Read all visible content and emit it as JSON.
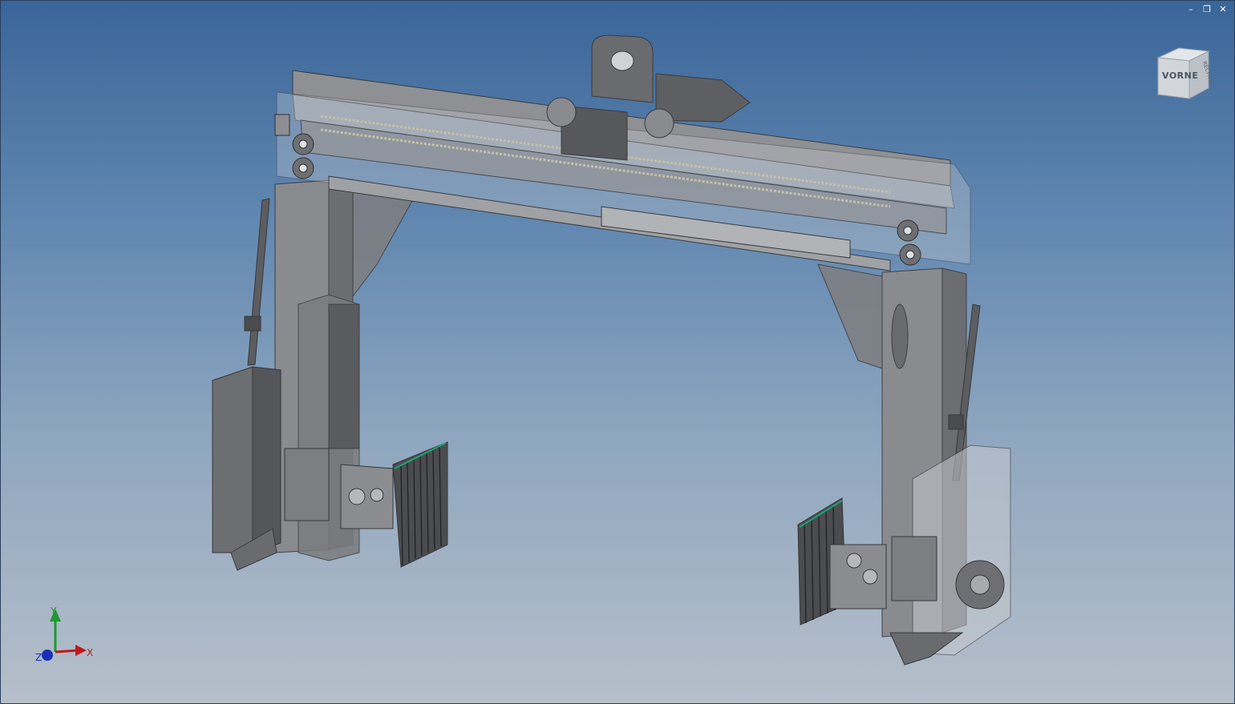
{
  "window": {
    "minimize_glyph": "–",
    "restore_glyph": "❐",
    "close_glyph": "✕"
  },
  "viewcube": {
    "front_label": "VORNE",
    "side_label": "RECHTS"
  },
  "triad": {
    "x_label": "X",
    "y_label": "Y",
    "z_label": "Z",
    "x_color": "#c0181c",
    "y_color": "#1f9a2e",
    "z_color": "#1c2fb8"
  },
  "colors": {
    "bg_top": "#3a6598",
    "bg_bottom": "#b6bfca",
    "part_dark": "#5a5b5e",
    "part_mid": "#7a7b7f",
    "part_light": "#a3a5a9",
    "ghost": "#c9ccd2",
    "accent_green": "#1aa672"
  }
}
